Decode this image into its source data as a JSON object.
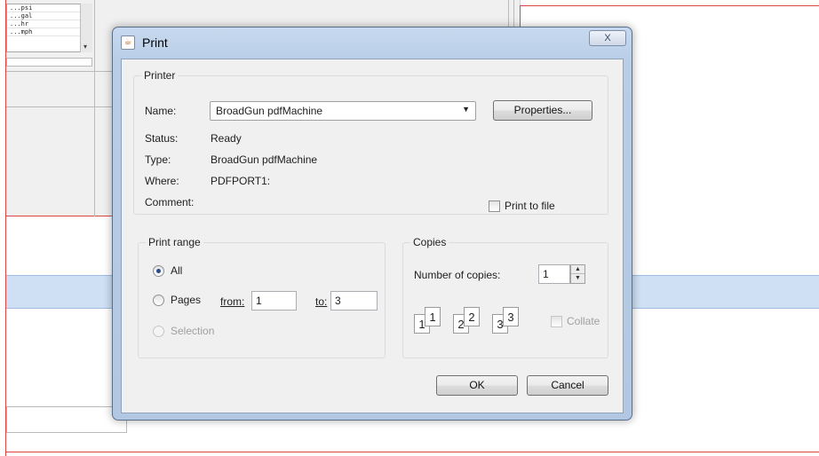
{
  "background": {
    "units": [
      "...psi",
      "...gal",
      "...hr",
      "...mph"
    ]
  },
  "dialog": {
    "title": "Print",
    "close_label": "X",
    "printer": {
      "group_label": "Printer",
      "name_label": "Name:",
      "name_value": "BroadGun pdfMachine",
      "properties_label": "Properties...",
      "status_label": "Status:",
      "status_value": "Ready",
      "type_label": "Type:",
      "type_value": "BroadGun pdfMachine",
      "where_label": "Where:",
      "where_value": "PDFPORT1:",
      "comment_label": "Comment:",
      "print_to_file_label": "Print to file"
    },
    "range": {
      "group_label": "Print range",
      "all_label": "All",
      "pages_label": "Pages",
      "from_label": "from:",
      "from_value": "1",
      "to_label": "to:",
      "to_value": "3",
      "selection_label": "Selection"
    },
    "copies": {
      "group_label": "Copies",
      "number_label": "Number of copies:",
      "number_value": "1",
      "collate_label": "Collate",
      "collate_pages": [
        "1",
        "1",
        "2",
        "2",
        "3",
        "3"
      ]
    },
    "ok_label": "OK",
    "cancel_label": "Cancel"
  }
}
